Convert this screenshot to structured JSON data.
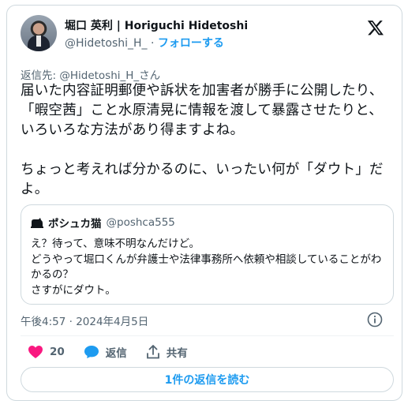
{
  "author": {
    "name": "堀口 英利 | Horiguchi Hidetoshi",
    "handle": "@Hidetoshi_H_",
    "separator": "·",
    "follow_label": "フォローする"
  },
  "reply_to": {
    "prefix": "返信先: ",
    "mention": "@Hidetoshi_H_さん"
  },
  "tweet": {
    "text": "届いた内容証明郵便や訴状を加害者が勝手に公開したり、「暇空茜」こと水原清晃に情報を渡して暴露させたりと、いろいろな方法があり得ますよね。\n\nちょっと考えれば分かるのに、いったい何が「ダウト」だよ。"
  },
  "quote": {
    "name": "ポシュカ猫",
    "handle": "@poshca555",
    "text": "え？待って、意味不明なんだけど。\nどうやって堀口くんが弁護士や法律事務所へ依頼や相談していることがわかるの？\nさすがにダウト。"
  },
  "timestamp": "午後4:57 · 2024年4月5日",
  "actions": {
    "like_count": "20",
    "reply_label": "返信",
    "share_label": "共有"
  },
  "read_replies_label": "1件の返信を読む",
  "colors": {
    "accent": "#1d9bf0",
    "like": "#f91880",
    "muted": "#536471",
    "border": "#cfd9de"
  },
  "icons": [
    "x-logo-icon",
    "info-icon",
    "heart-icon",
    "reply-bubble-icon",
    "share-upload-icon",
    "cat-avatar-icon"
  ]
}
